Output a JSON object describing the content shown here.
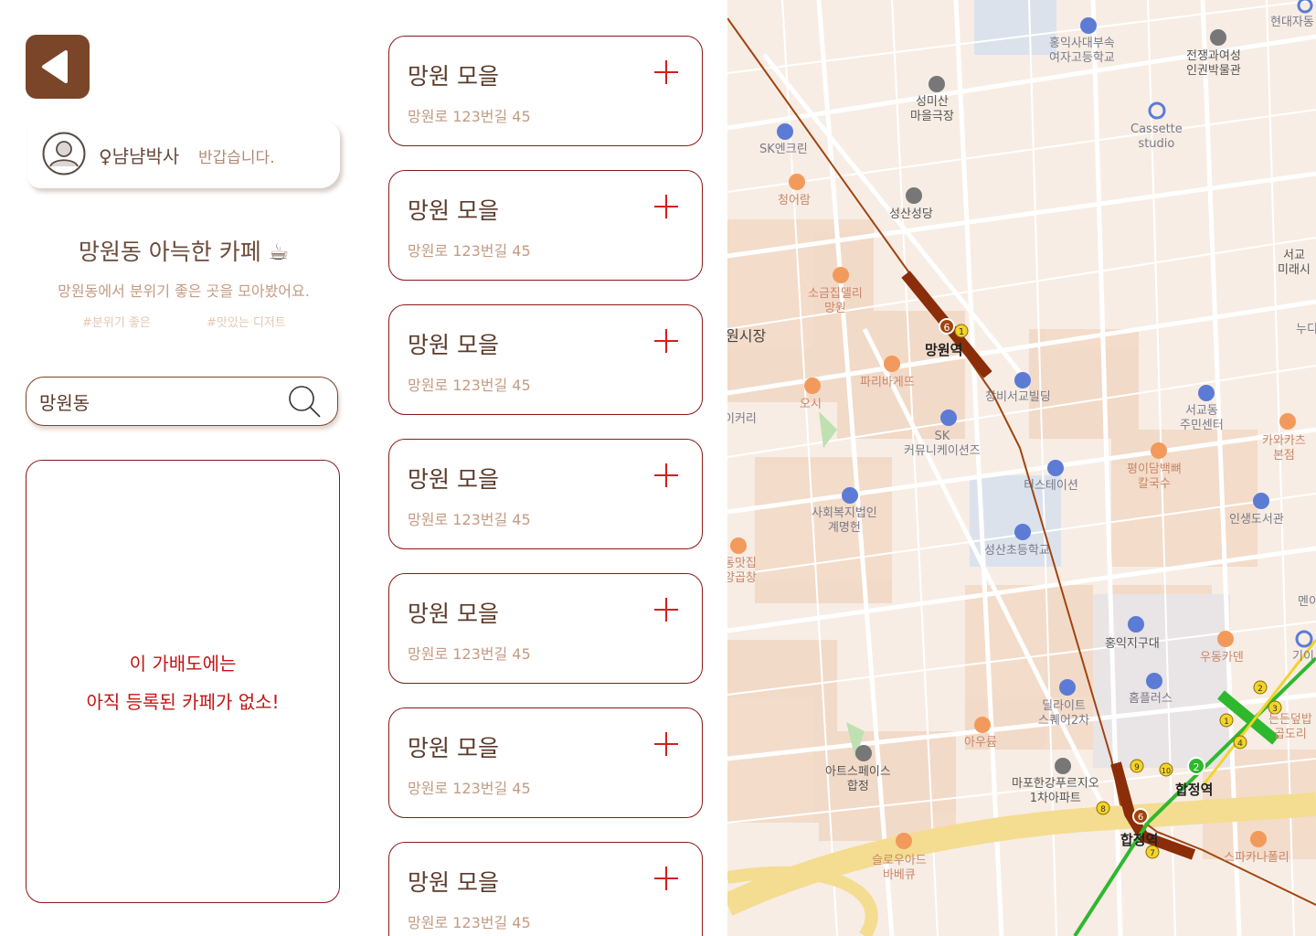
{
  "colors": {
    "brown": "#7a4528",
    "red_border": "#8a1818",
    "red_text": "#c41414",
    "plus": "#d41e1e"
  },
  "user": {
    "name": "♀냠냠박사",
    "greeting": "반갑습니다."
  },
  "collection": {
    "title": "망원동 아늑한 카페 ☕",
    "description": "망원동에서 분위기 좋은 곳을 모아봤어요.",
    "tags": [
      "#분위기 좋은",
      "#맛있는 디저트"
    ]
  },
  "search": {
    "value": "망원동"
  },
  "empty": {
    "line1": "이 가배도에는",
    "line2": "아직 등록된 카페가 없소!"
  },
  "cafes": [
    {
      "name": "망원 모을",
      "address": "망원로 123번길 45"
    },
    {
      "name": "망원 모을",
      "address": "망원로 123번길 45"
    },
    {
      "name": "망원 모을",
      "address": "망원로 123번길 45"
    },
    {
      "name": "망원 모을",
      "address": "망원로 123번길 45"
    },
    {
      "name": "망원 모을",
      "address": "망원로 123번길 45"
    },
    {
      "name": "망원 모을",
      "address": "망원로 123번길 45"
    },
    {
      "name": "망원 모을",
      "address": "망원로 123번길 45"
    }
  ],
  "map": {
    "stations": {
      "mangwon": "망원역",
      "hapjeong": "합정역",
      "hapjeong2": "합정역"
    },
    "districts": {
      "market": "원시장",
      "bakery": "이커리"
    },
    "places": {
      "hongik_girls": "홍익사대부속\n여자고등학교",
      "war_museum": "전쟁과여성\n인권박물관",
      "hyundai": "현대자동",
      "seongmisan": "성미산\n마을극장",
      "cassette": "Cassette\nstudio",
      "sk_enclean": "SK엔크린",
      "cheongeoram": "청어람",
      "seongsan_cathedral": "성산성당",
      "seogyo_future": "서교\n미래시",
      "sogeumjip": "소금집델리\n망원",
      "paris": "파리바게뜨",
      "changbi": "창비서교빌딩",
      "osi": "오시",
      "sk_comm": "SK\n커뮤니케이션즈",
      "seogyo_center": "서교동\n주민센터",
      "kawakas": "카와카츠\n본점",
      "tstation": "티스테이션",
      "pyeongidam": "평이담백뼈\n칼국수",
      "welfare": "사회복지법인\n계명헌",
      "seongsan_elem": "성산초등학교",
      "insaeng": "인생도서관",
      "dongmat": "동맛집\n양곱창",
      "hongik_gudae": "홍익지구대",
      "udong": "우동카덴",
      "delight": "딜라이트\n스퀘어2차",
      "homeplus": "홈플러스",
      "auryum": "아우륨",
      "artspace": "아트스페이스\n합정",
      "mapo_river": "마포한강푸르지오\n1차아파트",
      "slow": "슬로우아드\n바베큐",
      "spacca": "스파카나폴리",
      "teunteun": "든든덮밥\n곱도리",
      "nu": "누디",
      "me": "멘이",
      "gio": "기이"
    }
  }
}
